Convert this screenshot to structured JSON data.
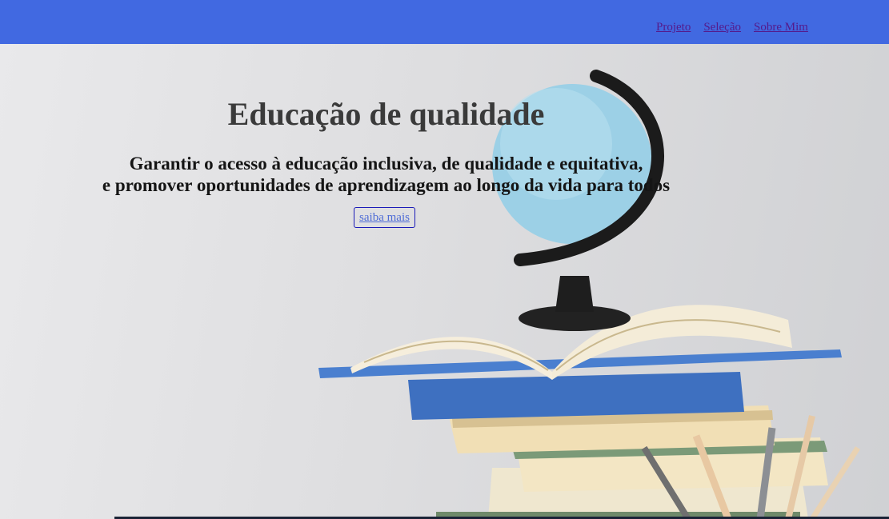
{
  "nav": {
    "items": [
      {
        "label": "Projeto"
      },
      {
        "label": "Seleção"
      },
      {
        "label": "Sobre Mim"
      }
    ]
  },
  "hero": {
    "title": "Educação de qualidade",
    "subtitle_line1": "Garantir o acesso à educação inclusiva, de qualidade e equitativa,",
    "subtitle_line2": "e promover oportunidades de aprendizagem ao longo da vida para todos",
    "cta_label": "saiba mais"
  },
  "colors": {
    "topbar": "#4169e1",
    "link_visited": "#551a8b",
    "cta_text": "#4d6bd6",
    "cta_border": "#1b1bb8"
  },
  "icons": {
    "illustration": "globe-and-books-image"
  }
}
